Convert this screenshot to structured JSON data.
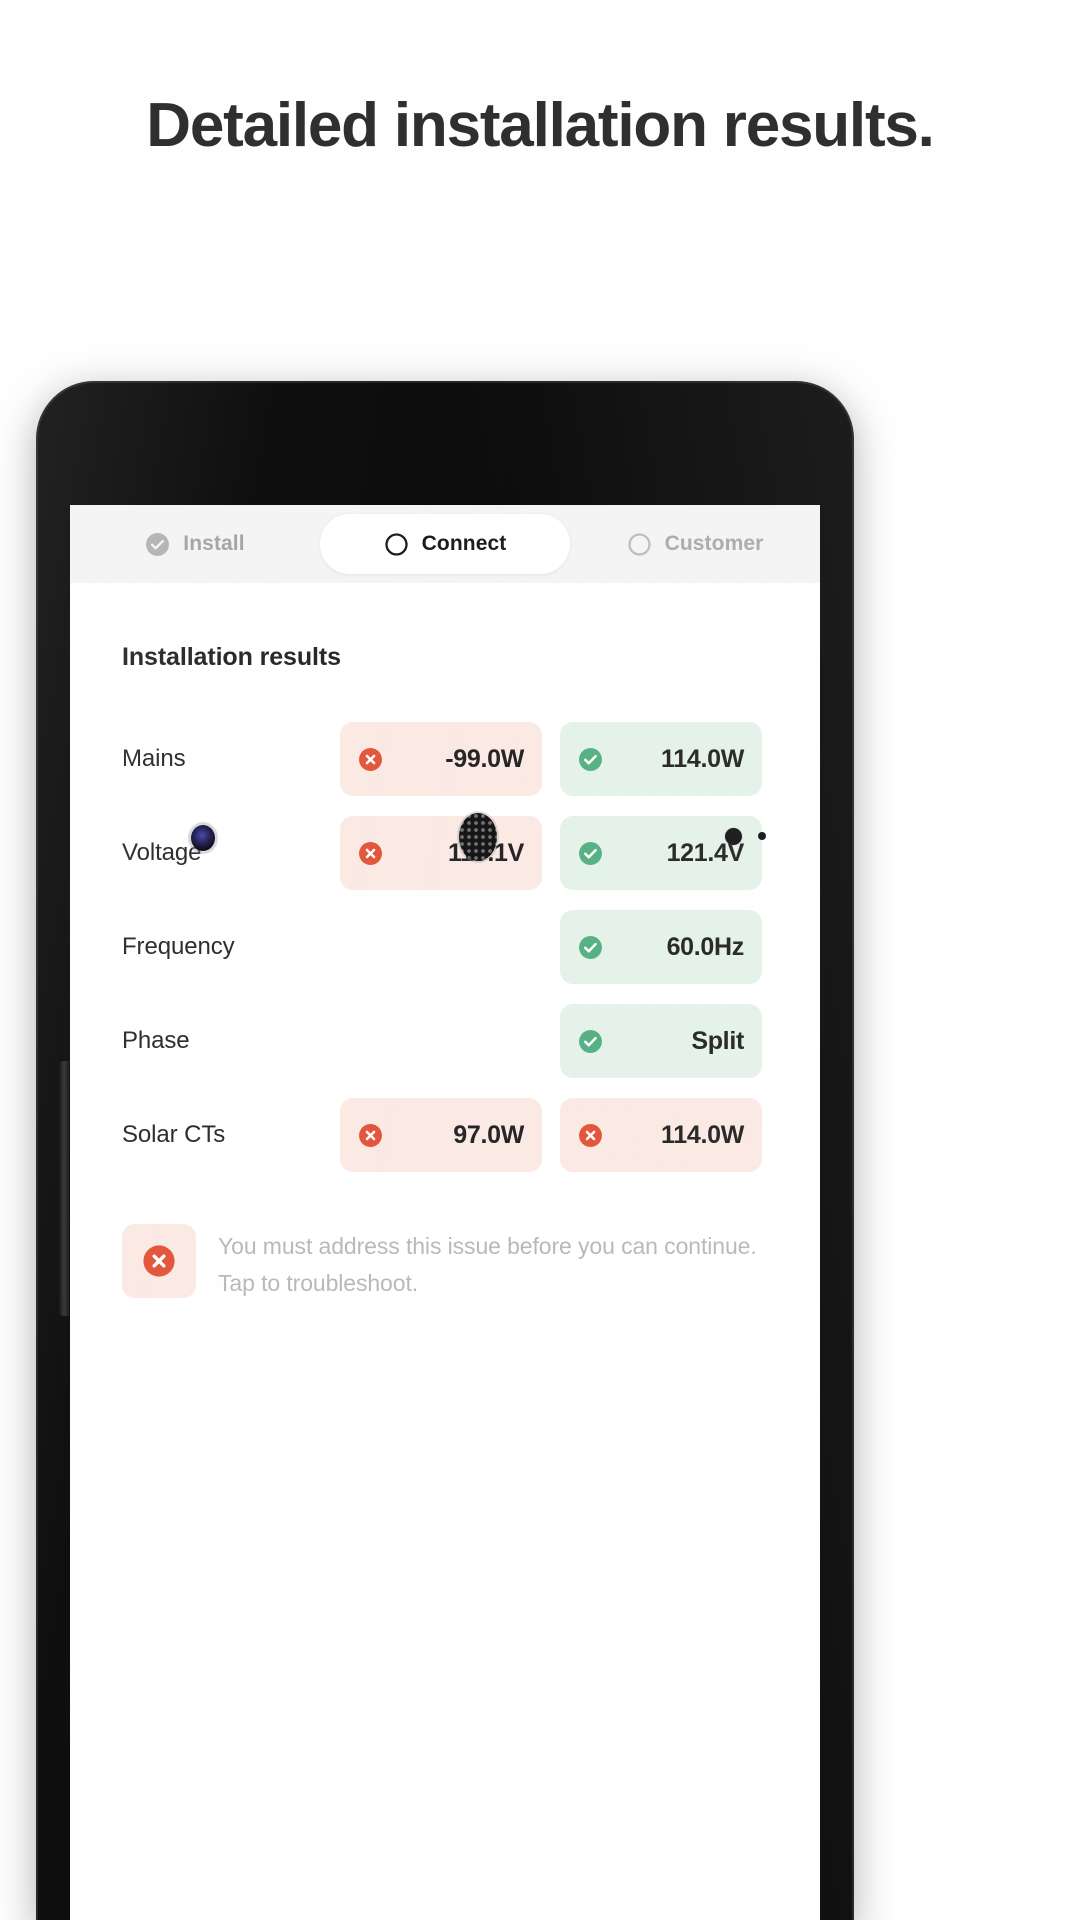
{
  "headline": "Detailed installation results.",
  "phone": {
    "hardware": {
      "front_camera": "front-camera",
      "earpiece": "earpiece-speaker",
      "power_button": "power-button",
      "volume_button": "volume-button"
    }
  },
  "app": {
    "tabs": [
      {
        "label": "Install",
        "state": "done",
        "icon": "check-circle-filled-icon"
      },
      {
        "label": "Connect",
        "state": "active",
        "icon": "circle-outline-icon"
      },
      {
        "label": "Customer",
        "state": "upcoming",
        "icon": "circle-outline-icon"
      }
    ],
    "section_title": "Installation results",
    "results": [
      {
        "label": "Mains",
        "cells": [
          {
            "status": "error",
            "value": "-99.0W",
            "icon": "x-circle-icon"
          },
          {
            "status": "success",
            "value": "114.0W",
            "icon": "check-circle-icon"
          }
        ]
      },
      {
        "label": "Voltage",
        "cells": [
          {
            "status": "error",
            "value": "110.1V",
            "icon": "x-circle-icon"
          },
          {
            "status": "success",
            "value": "121.4V",
            "icon": "check-circle-icon"
          }
        ]
      },
      {
        "label": "Frequency",
        "cells": [
          {
            "status": "empty",
            "value": "",
            "icon": ""
          },
          {
            "status": "success",
            "value": "60.0Hz",
            "icon": "check-circle-icon"
          }
        ]
      },
      {
        "label": "Phase",
        "cells": [
          {
            "status": "empty",
            "value": "",
            "icon": ""
          },
          {
            "status": "success",
            "value": "Split",
            "icon": "check-circle-icon"
          }
        ]
      },
      {
        "label": "Solar CTs",
        "cells": [
          {
            "status": "error",
            "value": "97.0W",
            "icon": "x-circle-icon"
          },
          {
            "status": "error",
            "value": "114.0W",
            "icon": "x-circle-icon"
          }
        ]
      }
    ],
    "note": {
      "icon": "x-circle-icon",
      "text": "You must address this issue before you can continue. Tap to troubleshoot."
    }
  },
  "colors": {
    "error_red": "#e2573c",
    "error_bg": "#fbe9e4",
    "success_green": "#57b184",
    "success_bg": "#e4f2ea",
    "tab_active_bg": "#ffffff",
    "tabbar_bg": "#f4f4f4",
    "headline_text": "#2f2f2f",
    "muted_text": "#b9b9b9"
  }
}
